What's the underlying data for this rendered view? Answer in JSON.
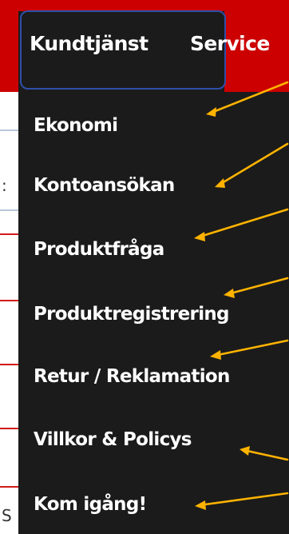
{
  "nav": {
    "active_label": "Kundtjänst",
    "next_label": "Service"
  },
  "dropdown": {
    "items": [
      {
        "label": "Ekonomi"
      },
      {
        "label": "Kontoansökan"
      },
      {
        "label": "Produktfråga"
      },
      {
        "label": "Produktregistrering"
      },
      {
        "label": "Retur / Reklamation"
      },
      {
        "label": "Villkor & Policys"
      },
      {
        "label": "Kom igång!"
      }
    ]
  },
  "background": {
    "partial_chars": [
      ":",
      "S"
    ]
  },
  "colors": {
    "nav_red": "#cc0000",
    "menu_dark": "#1b1b1b",
    "focus_ring": "#2f4fa8",
    "arrow": "#ffb300"
  }
}
